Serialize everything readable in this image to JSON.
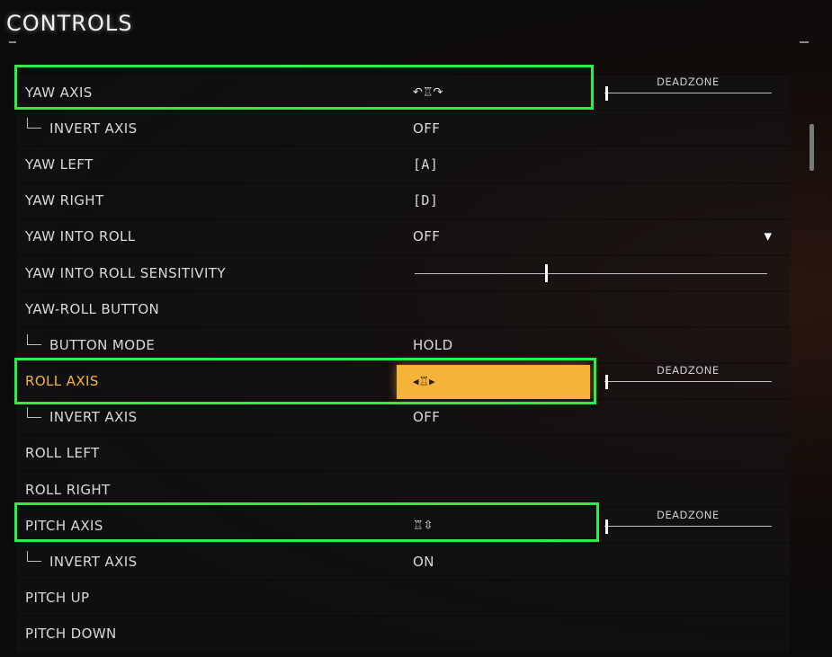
{
  "header": {
    "title": "CONTROLS"
  },
  "deadzone_label": "DEADZONE",
  "rows": [
    {
      "label": "YAW AXIS",
      "value": "",
      "icon": "yaw-joystick-icon"
    },
    {
      "label": "INVERT AXIS",
      "value": "OFF"
    },
    {
      "label": "YAW LEFT",
      "value": "[A]"
    },
    {
      "label": "YAW RIGHT",
      "value": "[D]"
    },
    {
      "label": "YAW INTO ROLL",
      "value": "OFF"
    },
    {
      "label": "YAW INTO ROLL SENSITIVITY",
      "slider_value": 0.37
    },
    {
      "label": "YAW-ROLL BUTTON",
      "value": ""
    },
    {
      "label": "BUTTON MODE",
      "value": "HOLD"
    },
    {
      "label": "ROLL AXIS",
      "value": "",
      "icon": "roll-joystick-icon",
      "active": true
    },
    {
      "label": "INVERT AXIS",
      "value": "OFF"
    },
    {
      "label": "ROLL LEFT",
      "value": ""
    },
    {
      "label": "ROLL RIGHT",
      "value": ""
    },
    {
      "label": "PITCH AXIS",
      "value": "",
      "icon": "pitch-joystick-icon"
    },
    {
      "label": "INVERT AXIS",
      "value": "ON"
    },
    {
      "label": "PITCH UP",
      "value": ""
    },
    {
      "label": "PITCH DOWN",
      "value": ""
    }
  ],
  "colors": {
    "highlight_box": "#2bee48",
    "active_orange": "#f6b33a",
    "background": "#0b0b0c"
  }
}
